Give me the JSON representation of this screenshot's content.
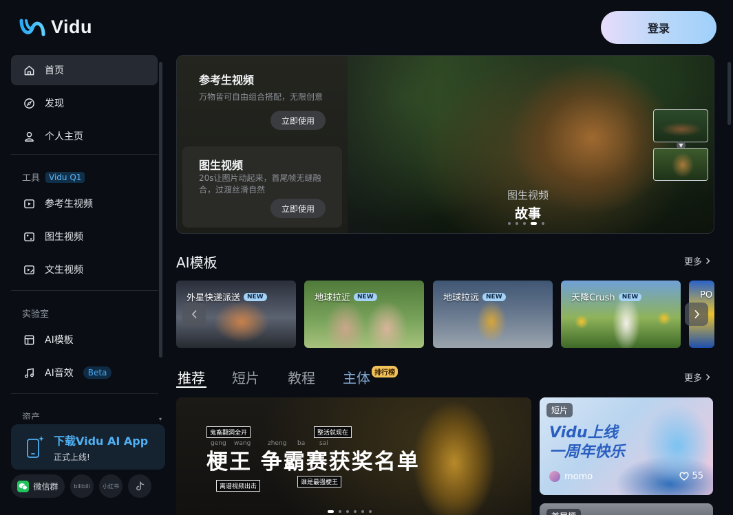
{
  "header": {
    "logo_text": "Vidu",
    "login_label": "登录"
  },
  "sidebar": {
    "main_items": [
      {
        "label": "首页",
        "icon": "home-icon",
        "active": true
      },
      {
        "label": "发现",
        "icon": "compass-icon"
      },
      {
        "label": "个人主页",
        "icon": "user-icon"
      }
    ],
    "tools_label": "工具",
    "tools_tag": "Vidu Q1",
    "tool_items": [
      {
        "label": "参考生视频",
        "icon": "reference-video-icon"
      },
      {
        "label": "图生视频",
        "icon": "image-video-icon"
      },
      {
        "label": "文生视频",
        "icon": "text-video-icon"
      }
    ],
    "lab_label": "实验室",
    "lab_items": [
      {
        "label": "AI模板",
        "icon": "template-icon"
      },
      {
        "label": "AI音效",
        "icon": "music-icon",
        "badge": "Beta"
      }
    ],
    "assets_label": "资产",
    "app_card": {
      "title": "下载Vidu AI App",
      "subtitle": "正式上线!"
    },
    "social": {
      "wechat_label": "微信群",
      "bilibili_label": "bilibili",
      "xiaohongshu_label": "小红书"
    }
  },
  "hero": {
    "feature1": {
      "title": "参考生视频",
      "desc": "万物皆可自由组合搭配，无限创意",
      "button": "立即使用"
    },
    "feature2": {
      "title": "图生视频",
      "desc_line1": "20s让图片动起来，首尾帧无缝融",
      "desc_line2": "合，过渡丝滑自然",
      "button": "立即使用"
    },
    "caption_sub": "图生视频",
    "caption_main": "故事",
    "slide_count": 5,
    "active_slide": 4
  },
  "templates": {
    "title": "AI模板",
    "more_label": "更多",
    "new_badge": "NEW",
    "items": [
      {
        "label": "外星快递派送",
        "is_new": true
      },
      {
        "label": "地球拉近",
        "is_new": true
      },
      {
        "label": "地球拉远",
        "is_new": true
      },
      {
        "label": "天降Crush",
        "is_new": true
      },
      {
        "label": "PO",
        "is_new": false
      }
    ]
  },
  "feed": {
    "tabs": [
      "推荐",
      "短片",
      "教程",
      "主体"
    ],
    "active_tab": "推荐",
    "rank_badge": "排行榜",
    "more_label": "更多",
    "big_card": {
      "headline": "梗王 争霸赛获奖名单",
      "stickers": [
        "鬼畜翻洞全开",
        "整活就现在",
        "离谱视频出击",
        "谁是最强梗王"
      ],
      "pinyin": [
        "geng",
        "wang",
        "zheng",
        "ba",
        "sai"
      ],
      "slide_count": 6,
      "active_slide": 1
    },
    "card1": {
      "tag": "短片",
      "title_line1": "Vidu上线",
      "title_line2": "一周年快乐",
      "author": "momo",
      "likes": "55"
    },
    "card2": {
      "tag": "首届梗"
    }
  },
  "colors": {
    "accent": "#4fb0f4",
    "login_gradient_start": "#e7dcfb",
    "login_gradient_end": "#9fd0fb",
    "background": "#0a0e14"
  }
}
